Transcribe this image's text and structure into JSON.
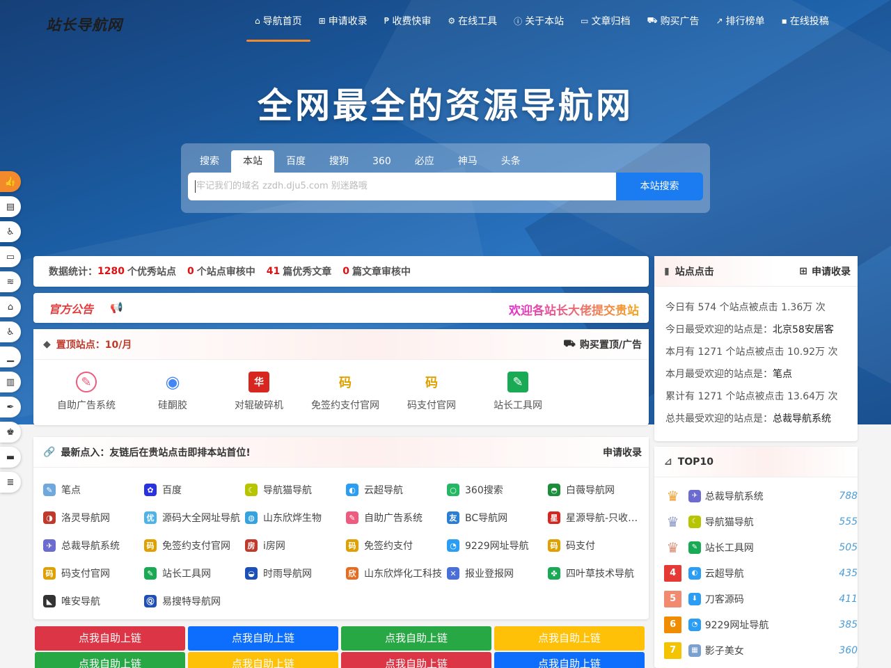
{
  "brand": {
    "logo": "站长导航网"
  },
  "nav": [
    {
      "label": "导航首页",
      "icon": "home-icon",
      "glyph": "⌂",
      "active": true
    },
    {
      "label": "申请收录",
      "icon": "plus-square-icon",
      "glyph": "⊞"
    },
    {
      "label": "收费快审",
      "icon": "paypal-icon",
      "glyph": "₱"
    },
    {
      "label": "在线工具",
      "icon": "gears-icon",
      "glyph": "⚙"
    },
    {
      "label": "关于本站",
      "icon": "info-circle-icon",
      "glyph": "ⓘ"
    },
    {
      "label": "文章归档",
      "icon": "folder-open-icon",
      "glyph": "▭"
    },
    {
      "label": "购买广告",
      "icon": "cart-icon",
      "glyph": "⛟"
    },
    {
      "label": "排行榜单",
      "icon": "line-chart-icon",
      "glyph": "↗"
    },
    {
      "label": "在线投稿",
      "icon": "comment-icon",
      "glyph": "▪"
    }
  ],
  "hero": {
    "title": "全网最全的资源导航网"
  },
  "search": {
    "tabs": [
      "搜索",
      "本站",
      "百度",
      "搜狗",
      "360",
      "必应",
      "神马",
      "头条"
    ],
    "active_tab": "本站",
    "placeholder": "牢记我们的域名 zzdh.dju5.com 别迷路哦",
    "button": "本站搜索"
  },
  "sidebar": [
    {
      "icon": "thumbs-up-icon",
      "glyph": "👍",
      "active": true
    },
    {
      "icon": "archive-icon",
      "glyph": "▤"
    },
    {
      "icon": "accessibility-icon",
      "glyph": "♿"
    },
    {
      "icon": "laptop-icon",
      "glyph": "▭"
    },
    {
      "icon": "rss-icon",
      "glyph": "≋"
    },
    {
      "icon": "home-icon",
      "glyph": "⌂"
    },
    {
      "icon": "accessibility-icon",
      "glyph": "♿"
    },
    {
      "icon": "bar-chart-icon",
      "glyph": "▁"
    },
    {
      "icon": "bank-icon",
      "glyph": "▥"
    },
    {
      "icon": "feather-icon",
      "glyph": "✒"
    },
    {
      "icon": "chess-icon",
      "glyph": "♚"
    },
    {
      "icon": "wallet-icon",
      "glyph": "▬"
    },
    {
      "icon": "list-icon",
      "glyph": "≣"
    }
  ],
  "stats": {
    "prefix": "数据统计：",
    "sites": "1280",
    "sites_label": "个优秀站点",
    "pending_sites": "0",
    "pending_sites_label": "个站点审核中",
    "articles": "41",
    "articles_label": "篇优秀文章",
    "pending_articles": "0",
    "pending_articles_label": "篇文章审核中"
  },
  "notice": {
    "official": "官方公告",
    "scroll_text": "欢迎各站长大佬提交贵站"
  },
  "top_sites": {
    "title": "置顶站点：10/月",
    "buy_label": "购买置顶/广告",
    "items": [
      {
        "name": "自助广告系统",
        "icon": "feather-circle-icon",
        "glyph": "✎",
        "color": "#ef5b7e"
      },
      {
        "name": "硅酮胶",
        "icon": "chrome-icon",
        "glyph": "◉",
        "color": "#4285f4"
      },
      {
        "name": "对辊破碎机",
        "icon": "huayou-logo-icon",
        "glyph": "华",
        "color": "#d7261f"
      },
      {
        "name": "免签约支付官网",
        "icon": "ma-icon",
        "glyph": "码",
        "color": "#e0a100"
      },
      {
        "name": "码支付官网",
        "icon": "ma-icon",
        "glyph": "码",
        "color": "#e0a100"
      },
      {
        "name": "站长工具网",
        "icon": "wrench-icon",
        "glyph": "✎",
        "color": "#1aaa55"
      }
    ]
  },
  "newest": {
    "title": "最新点入：友链后在贵站点击即排本站首位!",
    "apply_label": "申请收录",
    "items": [
      {
        "name": "笔点",
        "glyph": "✎",
        "color": "#6fa8dc"
      },
      {
        "name": "百度",
        "glyph": "✿",
        "color": "#2932e1"
      },
      {
        "name": "导航猫导航",
        "glyph": "☾",
        "color": "#b7c400"
      },
      {
        "name": "云超导航",
        "glyph": "◐",
        "color": "#2a9df4"
      },
      {
        "name": "360搜索",
        "glyph": "○",
        "color": "#25b864"
      },
      {
        "name": "白薇导航网",
        "glyph": "◓",
        "color": "#1a8e3b"
      },
      {
        "name": "洛灵导航网",
        "glyph": "◑",
        "color": "#c0392b"
      },
      {
        "name": "源码大全网址导航",
        "glyph": "优",
        "color": "#4fb3e8"
      },
      {
        "name": "山东欣烨生物",
        "glyph": "◍",
        "color": "#36a3e0"
      },
      {
        "name": "自助广告系统",
        "glyph": "✎",
        "color": "#ef5b7e"
      },
      {
        "name": "BC导航网",
        "glyph": "友",
        "color": "#2a7fd4"
      },
      {
        "name": "星源导航-只收录优质网站",
        "glyph": "星",
        "color": "#d7261f"
      },
      {
        "name": "总裁导航系统",
        "glyph": "✈",
        "color": "#6b6bd0"
      },
      {
        "name": "免签约支付官网",
        "glyph": "码",
        "color": "#e0a100"
      },
      {
        "name": "i房网",
        "glyph": "房",
        "color": "#c0392b"
      },
      {
        "name": "免签约支付",
        "glyph": "码",
        "color": "#e0a100"
      },
      {
        "name": "9229网址导航",
        "glyph": "◔",
        "color": "#2a9df4"
      },
      {
        "name": "码支付",
        "glyph": "码",
        "color": "#e0a100"
      },
      {
        "name": "码支付官网",
        "glyph": "码",
        "color": "#e0a100"
      },
      {
        "name": "站长工具网",
        "glyph": "✎",
        "color": "#1aaa55"
      },
      {
        "name": "时雨导航网",
        "glyph": "◒",
        "color": "#1d4fb8"
      },
      {
        "name": "山东欣烨化工科技",
        "glyph": "欣",
        "color": "#e86c1f"
      },
      {
        "name": "报业登报网",
        "glyph": "✕",
        "color": "#4b6fd8"
      },
      {
        "name": "四叶草技术导航",
        "glyph": "✤",
        "color": "#1aaa55"
      },
      {
        "name": "唯安导航",
        "glyph": "◣",
        "color": "#333333"
      },
      {
        "name": "易搜特导航网",
        "glyph": "Ⓠ",
        "color": "#1d4fb8"
      }
    ]
  },
  "self_links": [
    {
      "label": "点我自助上链",
      "color": "#dc3545"
    },
    {
      "label": "点我自助上链",
      "color": "#0d6efd"
    },
    {
      "label": "点我自助上链",
      "color": "#28a745"
    },
    {
      "label": "点我自助上链",
      "color": "#ffc107"
    },
    {
      "label": "点我自助上链",
      "color": "#28a745"
    },
    {
      "label": "点我自助上链",
      "color": "#ffc107"
    },
    {
      "label": "点我自助上链",
      "color": "#dc3545"
    },
    {
      "label": "点我自助上链",
      "color": "#0d6efd"
    }
  ],
  "clicks": {
    "title": "站点点击",
    "apply_label": "申请收录",
    "lines": [
      {
        "text": "今日有 574 个站点被点击 1.36万 次",
        "highlight": ""
      },
      {
        "text": "今日最受欢迎的站点是：",
        "highlight": "北京58安居客"
      },
      {
        "text": "本月有 1271 个站点被点击 10.92万 次",
        "highlight": ""
      },
      {
        "text": "本月最受欢迎的站点是：",
        "highlight": "笔点"
      },
      {
        "text": "累计有 1271 个站点被点击 13.64万 次",
        "highlight": ""
      },
      {
        "text": "总共最受欢迎的站点是：",
        "highlight": "总裁导航系统"
      }
    ]
  },
  "top10": {
    "title": "TOP10",
    "items": [
      {
        "rank": "1",
        "crown": true,
        "crown_color": "#f0a030",
        "name": "总裁导航系统",
        "count": "788",
        "glyph": "✈",
        "color": "#6b6bd0"
      },
      {
        "rank": "2",
        "crown": true,
        "crown_color": "#8a95c8",
        "name": "导航猫导航",
        "count": "555",
        "glyph": "☾",
        "color": "#b7c400"
      },
      {
        "rank": "3",
        "crown": true,
        "crown_color": "#d98a72",
        "name": "站长工具网",
        "count": "505",
        "glyph": "✎",
        "color": "#1aaa55"
      },
      {
        "rank": "4",
        "crown": false,
        "badge_color": "#e53935",
        "name": "云超导航",
        "count": "435",
        "glyph": "◐",
        "color": "#2a9df4"
      },
      {
        "rank": "5",
        "crown": false,
        "badge_color": "#f28a70",
        "name": "刀客源码",
        "count": "411",
        "glyph": "⬇",
        "color": "#2a9df4"
      },
      {
        "rank": "6",
        "crown": false,
        "badge_color": "#f08c00",
        "name": "9229网址导航",
        "count": "385",
        "glyph": "◔",
        "color": "#2a9df4"
      },
      {
        "rank": "7",
        "crown": false,
        "badge_color": "#f5c400",
        "name": "影子美女",
        "count": "360",
        "glyph": "▦",
        "color": "#7aa0d0"
      }
    ]
  }
}
